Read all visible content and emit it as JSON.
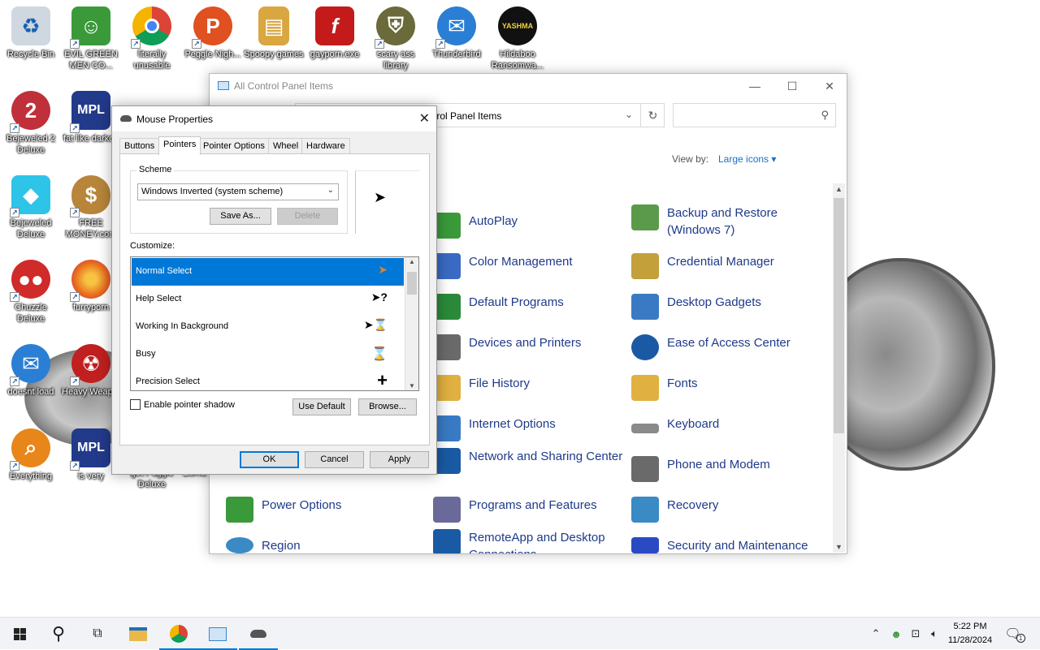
{
  "desktop": {
    "icons": [
      {
        "label": "Recycle Bin",
        "glyph": "recycle-bin-icon",
        "color": "#cfd8e0"
      },
      {
        "label": "EVIL GREEN MEN CO...",
        "glyph": "users-icon",
        "color": "#3a9a3a"
      },
      {
        "label": "literally unusable",
        "glyph": "chrome-icon",
        "color": "#db4437"
      },
      {
        "label": "Peggle Nigh...",
        "glyph": "peggle-icon",
        "color": "#e05020"
      },
      {
        "label": "Spoopy games",
        "glyph": "folder-icon",
        "color": "#d9a640"
      },
      {
        "label": "gayporn.exe",
        "glyph": "flash-icon",
        "color": "#c41a1a"
      },
      {
        "label": "scary ass library",
        "glyph": "shield-icon",
        "color": "#6a6a3a"
      },
      {
        "label": "Thunderbird",
        "glyph": "thunderbird-icon",
        "color": "#2a7ed4"
      },
      {
        "label": "Hildaboo Ransomwa...",
        "glyph": "yashma-icon",
        "color": "#111111"
      },
      {
        "label": "Bejeweled 2 Deluxe",
        "glyph": "gem-icon",
        "color": "#c0303a"
      },
      {
        "label": "fat like darkok",
        "glyph": "mpl-icon",
        "color": "#223a8a"
      },
      {
        "label": "Bejeweled Deluxe",
        "glyph": "diamond-icon",
        "color": "#2ec4e8"
      },
      {
        "label": "FREE MONEY.com",
        "glyph": "money-bag-icon",
        "color": "#b8853a"
      },
      {
        "label": "Chuzzle Deluxe",
        "glyph": "chuzzle-icon",
        "color": "#d02a2a"
      },
      {
        "label": "furryporn",
        "glyph": "firefox-icon",
        "color": "#e86a1a"
      },
      {
        "label": "doesnt load",
        "glyph": "thunderbird-icon",
        "color": "#2a7ed4"
      },
      {
        "label": "Heavy Weap...",
        "glyph": "radiation-icon",
        "color": "#c02020"
      },
      {
        "label": "Everything",
        "glyph": "search-icon",
        "color": "#e8861a"
      },
      {
        "label": "is very",
        "glyph": "mpl-icon",
        "color": "#223a8a"
      },
      {
        "label": "get Peggle Deluxe",
        "glyph": "peggle-icon",
        "color": "#e05020"
      },
      {
        "label": "Zuma",
        "glyph": "zuma-icon",
        "color": "#6a8a3a"
      }
    ]
  },
  "control_panel": {
    "title": "All Control Panel Items",
    "address": "trol Panel Items",
    "search_placeholder": "",
    "view_by_label": "View by:",
    "view_by_value": "Large icons",
    "items": [
      {
        "label": "AutoPlay",
        "color": "#3a9a3a"
      },
      {
        "label": "Backup and Restore (Windows 7)",
        "color": "#5a9a4a"
      },
      {
        "label": "Color Management",
        "color": "#3a6ac4"
      },
      {
        "label": "Credential Manager",
        "color": "#c4a03a"
      },
      {
        "label": "Default Programs",
        "color": "#2a8a3a"
      },
      {
        "label": "Desktop Gadgets",
        "color": "#3a7ac4"
      },
      {
        "label": "Devices and Printers",
        "color": "#6a6a6a"
      },
      {
        "label": "Ease of Access Center",
        "color": "#1a5aa4"
      },
      {
        "label": "File History",
        "color": "#e0b040"
      },
      {
        "label": "Fonts",
        "color": "#e0b040"
      },
      {
        "label": "Internet Options",
        "color": "#3a7ac4"
      },
      {
        "label": "Keyboard",
        "color": "#8a8a8a"
      },
      {
        "label": "Network and Sharing Center",
        "color": "#1a5aa4"
      },
      {
        "label": "Phone and Modem",
        "color": "#6a6a6a"
      },
      {
        "label": "Power Options",
        "color": "#3a9a3a"
      },
      {
        "label": "Programs and Features",
        "color": "#6a6a9a"
      },
      {
        "label": "Recovery",
        "color": "#3a8ac4"
      },
      {
        "label": "Region",
        "color": "#3a8ac4"
      },
      {
        "label": "RemoteApp and Desktop Connections",
        "color": "#1a5aa4"
      },
      {
        "label": "Security and Maintenance",
        "color": "#2a4ac4"
      }
    ]
  },
  "mouse_properties": {
    "title": "Mouse Properties",
    "tabs": [
      "Buttons",
      "Pointers",
      "Pointer Options",
      "Wheel",
      "Hardware"
    ],
    "active_tab": "Pointers",
    "scheme_label": "Scheme",
    "scheme_value": "Windows Inverted (system scheme)",
    "save_as_label": "Save As...",
    "delete_label": "Delete",
    "customize_label": "Customize:",
    "pointers": [
      {
        "name": "Normal Select",
        "glyph": "➤"
      },
      {
        "name": "Help Select",
        "glyph": "➤?"
      },
      {
        "name": "Working In Background",
        "glyph": "➤⌛"
      },
      {
        "name": "Busy",
        "glyph": "⌛"
      },
      {
        "name": "Precision Select",
        "glyph": "+"
      }
    ],
    "selected_pointer": "Normal Select",
    "enable_shadow_label": "Enable pointer shadow",
    "use_default_label": "Use Default",
    "browse_label": "Browse...",
    "ok_label": "OK",
    "cancel_label": "Cancel",
    "apply_label": "Apply"
  },
  "taskbar": {
    "time": "5:22 PM",
    "date": "11/28/2024",
    "notification_count": "1"
  }
}
